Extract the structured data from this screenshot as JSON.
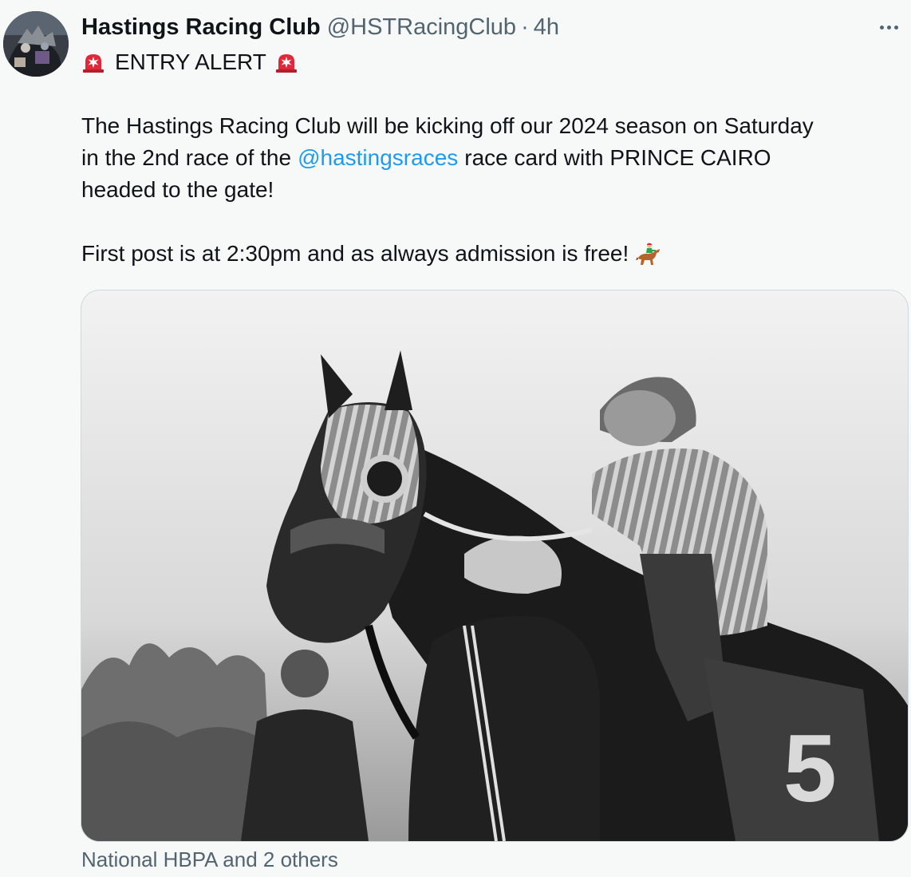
{
  "tweet": {
    "display_name": "Hastings Racing Club",
    "handle": "@HSTRacingClub",
    "separator": "·",
    "time": "4h",
    "lines": {
      "l1_text": "ENTRY ALERT",
      "l3_text": "The Hastings Racing Club will be kicking off our 2024 season on Saturday",
      "l4_before": "in the 2nd race of the",
      "l4_mention": "@hastingsraces",
      "l4_after": "race card with PRINCE CAIRO",
      "l5_text": "headed to the gate!",
      "l7_text": "First post is at 2:30pm and as always admission is free!"
    },
    "footer": "National HBPA and 2 others"
  },
  "icons": {
    "avatar": "avatar-image",
    "more": "more-options-icon",
    "siren": "rotating-light-emoji",
    "horse": "horse-racing-emoji"
  },
  "colors": {
    "mention": "#1d9bf0",
    "secondary_text": "#536471",
    "siren_red": "#e0283a"
  }
}
